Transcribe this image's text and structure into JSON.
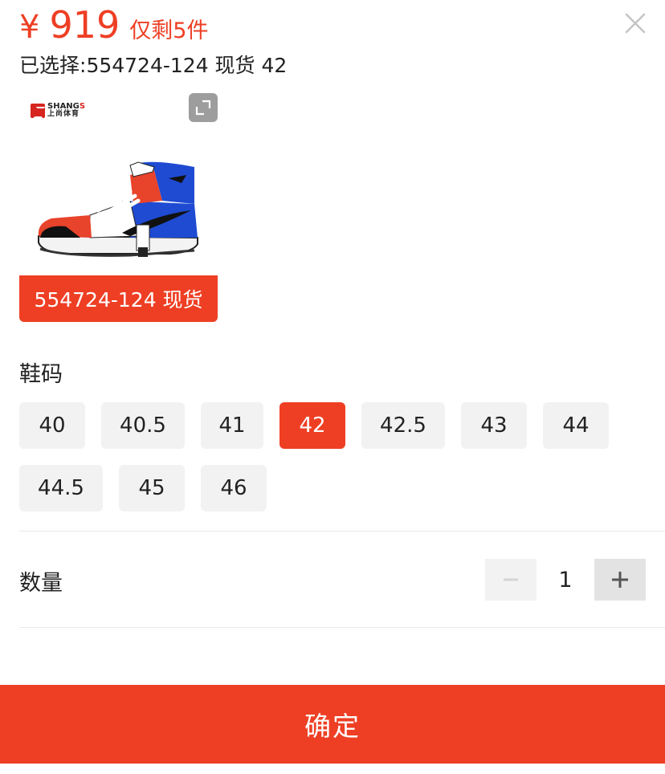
{
  "header": {
    "currency_symbol": "¥",
    "price": "919",
    "stock_note": "仅剩5件",
    "selected_prefix": "已选择: ",
    "selected_value": "554724-124 现货 42"
  },
  "product": {
    "brand_en_prefix": "SHANG",
    "brand_en_suffix": "S",
    "brand_cn": "上尚体育",
    "variant_label": "554724-124 现货"
  },
  "sizes": {
    "title": "鞋码",
    "selected": "42",
    "options": [
      "40",
      "40.5",
      "41",
      "42",
      "42.5",
      "43",
      "44",
      "44.5",
      "45",
      "46"
    ]
  },
  "quantity": {
    "label": "数量",
    "value": "1"
  },
  "footer": {
    "confirm_label": "确定"
  },
  "colors": {
    "accent": "#ee3f24",
    "chip_bg": "#f2f2f2",
    "text": "#222222"
  },
  "icons": {
    "close": "close-icon",
    "expand": "expand-icon",
    "minus": "minus-icon",
    "plus": "plus-icon"
  }
}
